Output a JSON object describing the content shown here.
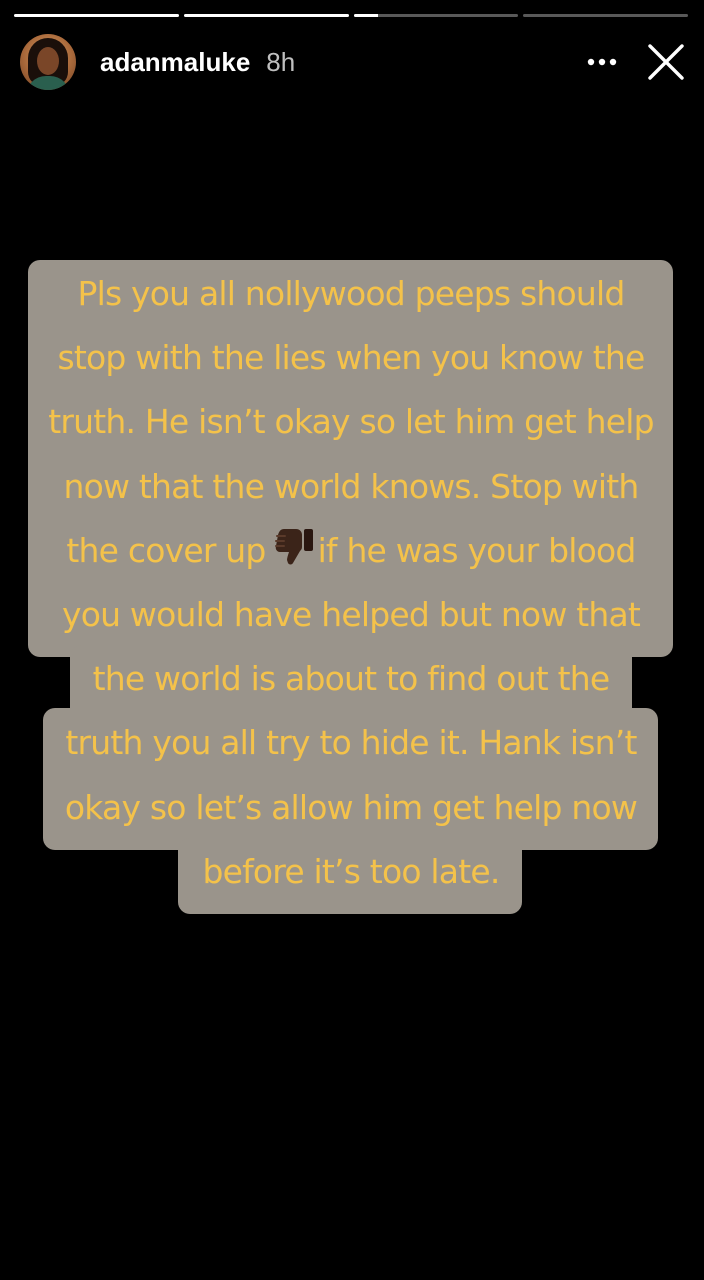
{
  "progress": [
    {
      "segment": 1,
      "fill_fraction": 1.0
    },
    {
      "segment": 2,
      "fill_fraction": 1.0
    },
    {
      "segment": 3,
      "fill_fraction": 0.15
    },
    {
      "segment": 4,
      "fill_fraction": 0.0
    }
  ],
  "header": {
    "username": "adanmaluke",
    "timestamp": "8h",
    "more_icon": "more-horizontal-icon",
    "close_icon": "close-icon"
  },
  "story": {
    "text_color": "#f4c24a",
    "bubble_color": "#9a948b",
    "lines": [
      "Pls you all nollywood peeps should",
      "stop with the lies when you know the",
      "truth. He isn’t okay so let him get help",
      "now that the world knows. Stop with",
      "the cover up",
      "if he was your blood",
      "you would have helped but now that",
      "the world is about to find out the",
      "truth you all try to hide it. Hank isn’t",
      "okay so let’s allow him get help now",
      "before it’s too late."
    ],
    "emoji": "thumbs-down-icon"
  }
}
